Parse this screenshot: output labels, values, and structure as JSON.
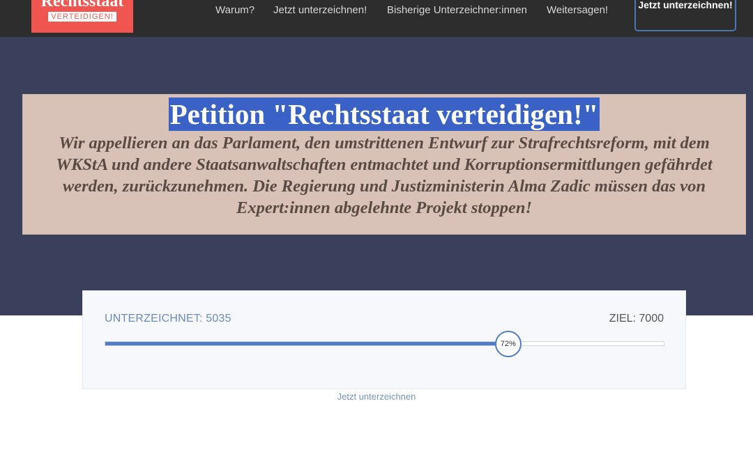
{
  "header": {
    "logo_main": "Rechtsstaat",
    "logo_sub": "VERTEIDIGEN!",
    "nav": [
      "Warum?",
      "Jetzt unterzeichnen!",
      "Bisherige Unterzeichner:innen",
      "Weitersagen!"
    ],
    "cta_label": "Jetzt unterzeichnen!"
  },
  "hero": {
    "title": "Petition \"Rechtsstaat verteidigen!\"",
    "description": "Wir appellieren an das Parlament, den umstrittenen Entwurf zur Strafrechtsreform, mit dem WKStA und andere Staatsanwaltschaften entmachtet und Korruptionsermittlungen gefährdet werden, zurückzunehmen. Die Regierung und Justizministerin Alma Zadic müssen das von Expert:innen abgelehnte Projekt stoppen!"
  },
  "progress": {
    "signed_label": "UNTERZEICHNET: 5035",
    "goal_label": "ZIEL: 7000",
    "percent": 72,
    "percent_label": "72%",
    "sign_link": "Jetzt unterzeichnen"
  },
  "colors": {
    "accent": "#4f7ec8",
    "logo_bg": "#f0554f",
    "hero_bg": "#3a3f5c",
    "hero_box_bg": "#d8c2b7"
  }
}
